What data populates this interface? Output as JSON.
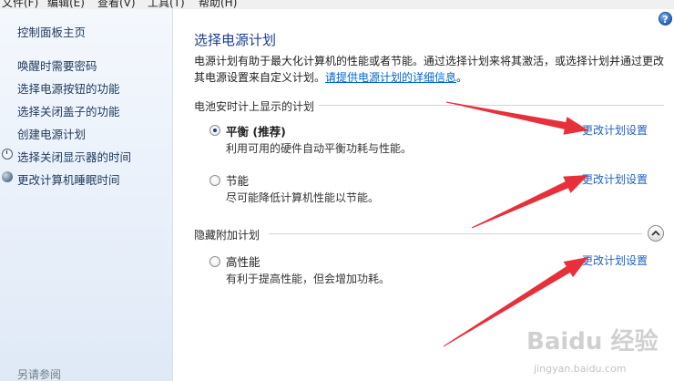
{
  "menubar": {
    "items": [
      "文件(F)",
      "编辑(E)",
      "查看(V)",
      "工具(T)",
      "帮助(H)"
    ]
  },
  "sidebar": {
    "home": "控制面板主页",
    "links": [
      {
        "label": "唤醒时需要密码",
        "icon": ""
      },
      {
        "label": "选择电源按钮的功能",
        "icon": ""
      },
      {
        "label": "选择关闭盖子的功能",
        "icon": ""
      },
      {
        "label": "创建电源计划",
        "icon": ""
      },
      {
        "label": "选择关闭显示器的时间",
        "icon": "display-clock-icon"
      },
      {
        "label": "更改计算机睡眠时间",
        "icon": "moon-icon"
      }
    ],
    "see_also": "另请参阅"
  },
  "main": {
    "title": "选择电源计划",
    "desc_line1": "电源计划有助于最大化计算机的性能或者节能。通过选择计划来将其激活，或选择计划并通过更改",
    "desc_line2_prefix": "其电源设置来自定义计划。",
    "desc_link": "请提供电源计划的详细信息",
    "desc_line2_suffix": "。",
    "battery_group": "电池安时计上显示的计划",
    "hidden_group": "隐藏附加计划",
    "plans": [
      {
        "name": "平衡 (推荐)",
        "desc": "利用可用的硬件自动平衡功耗与性能。",
        "selected": true,
        "change": "更改计划设置"
      },
      {
        "name": "节能",
        "desc": "尽可能降低计算机性能以节能。",
        "selected": false,
        "change": "更改计划设置"
      },
      {
        "name": "高性能",
        "desc": "有利于提高性能，但会增加功耗。",
        "selected": false,
        "change": "更改计划设置"
      }
    ],
    "help_glyph": "?"
  },
  "annotation": {
    "arrow_color": "#e8303a"
  },
  "watermark": {
    "logo": "Baidu 经验",
    "url": "jingyan.baidu.com"
  }
}
